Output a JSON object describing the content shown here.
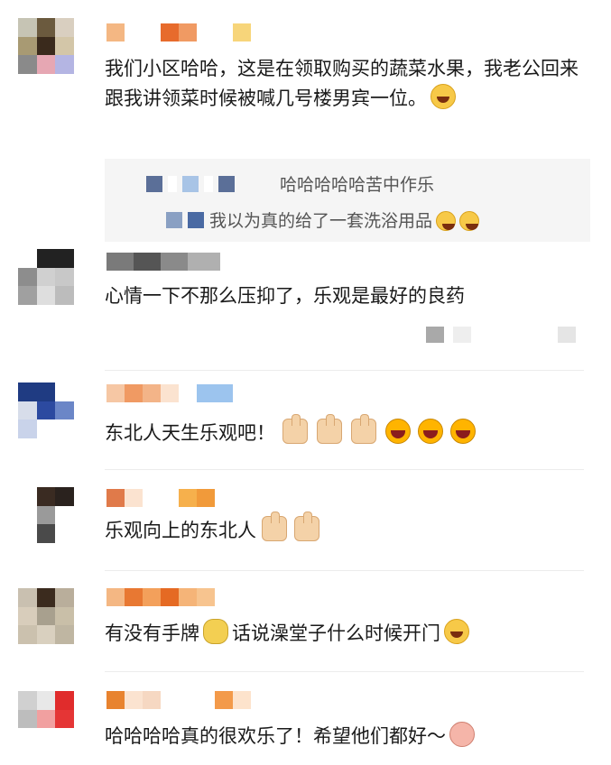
{
  "comments": [
    {
      "text": "我们小区哈哈，这是在领取购买的蔬菜水果，我老公回来跟我讲领菜时候被喊几号楼男宾一位。",
      "emoji": [
        "laughing-crying-emoji"
      ],
      "replies": [
        {
          "text": "哈哈哈哈哈苦中作乐"
        },
        {
          "text": "我以为真的给了一套洗浴用品"
        }
      ]
    },
    {
      "text": "心情一下不那么压抑了，乐观是最好的良药"
    },
    {
      "text": "东北人天生乐观吧！",
      "emoji": [
        "thumbs-up-emoji",
        "thumbs-up-emoji",
        "thumbs-up-emoji",
        "grinning-emoji",
        "grinning-emoji",
        "grinning-emoji"
      ]
    },
    {
      "text": "乐观向上的东北人",
      "emoji": [
        "thumbs-up-emoji",
        "thumbs-up-emoji"
      ]
    },
    {
      "text_a": "有没有手牌",
      "text_b": "话说澡堂子什么时候开门",
      "emoji": [
        "thinking-emoji",
        "laughing-crying-emoji"
      ]
    },
    {
      "text": "哈哈哈哈真的很欢乐了！希望他们都好～",
      "emoji": [
        "pig-emoji"
      ]
    }
  ],
  "colors": {
    "text": "#1a1a1a",
    "reply_background": "#f5f5f5",
    "divider": "#ececec",
    "mosaic_orange": "#f08a3c",
    "mosaic_blue": "#5b7fb8"
  }
}
